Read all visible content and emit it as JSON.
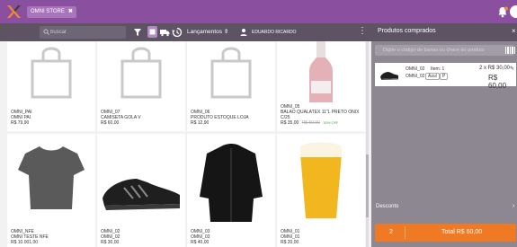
{
  "topbar": {
    "store_label": "OMNI STORE",
    "store_close": "✖",
    "icons": [
      "logo-x-icon",
      "bell-icon",
      "user-avatar-icon"
    ]
  },
  "subbar": {
    "search_placeholder": "buscar",
    "dropdown_label": "Lançamentos ⇕",
    "user_label": "EDUARDO RICARDO",
    "kebab": "⋮",
    "cart_title": "Produtos comprados",
    "cart_close": "×"
  },
  "products": [
    {
      "code": "OMNI_PAI",
      "name": "OMNI PAI",
      "price": "R$ 79,90",
      "image": "bag-placeholder"
    },
    {
      "code": "OMNI_07",
      "name": "CAMISETA GOLA V",
      "price": "R$ 60,00",
      "image": "bag-placeholder"
    },
    {
      "code": "OMNI_06",
      "name": "PRODUTO ESTOQUE LOJA",
      "price": "R$ 12,90",
      "image": "bag-placeholder"
    },
    {
      "code": "OMNI_05",
      "name": "BALAO QUALATEX 11\"L PRETO ONIX",
      "name2": "C/25",
      "price": "R$ 35,00",
      "old_price": "R$ 50,00",
      "discount": "30% OFF",
      "image": "wine-bottle"
    },
    {
      "code": "OMNI_NFE",
      "name": "OMNI TESTE NFE",
      "price": "R$ 10.001,00",
      "image": "gray-tshirt"
    },
    {
      "code": "OMNI_02",
      "name": "OMNI_02",
      "price": "R$ 30,00",
      "image": "black-sneaker"
    },
    {
      "code": "OMNI_03",
      "name": "OMNI_03",
      "price": "R$ 40,00",
      "image": "black-jacket"
    },
    {
      "code": "OMNI_01",
      "name": "OMNI_01",
      "price": "R$ 20,00",
      "image": "beer-glass"
    }
  ],
  "cart": {
    "barcode_placeholder": "Digite o código de barras ou chave do produto",
    "item": {
      "code": "OMNI_02",
      "item_no": "Item: 1",
      "qty_price": "2 x R$ 30,00",
      "ref": "OMNI_02",
      "color": "Azul",
      "size": "P",
      "total": "R$ 60,00"
    },
    "discount_label": "Desconto",
    "discount_chevron": "›",
    "total_count": "2",
    "total_label": "Total R$ 60,00"
  },
  "colors": {
    "primary": "#8a4f9e",
    "subbar": "#5d5363",
    "accent": "#ef7a23",
    "cart_panel": "#8c8790"
  }
}
